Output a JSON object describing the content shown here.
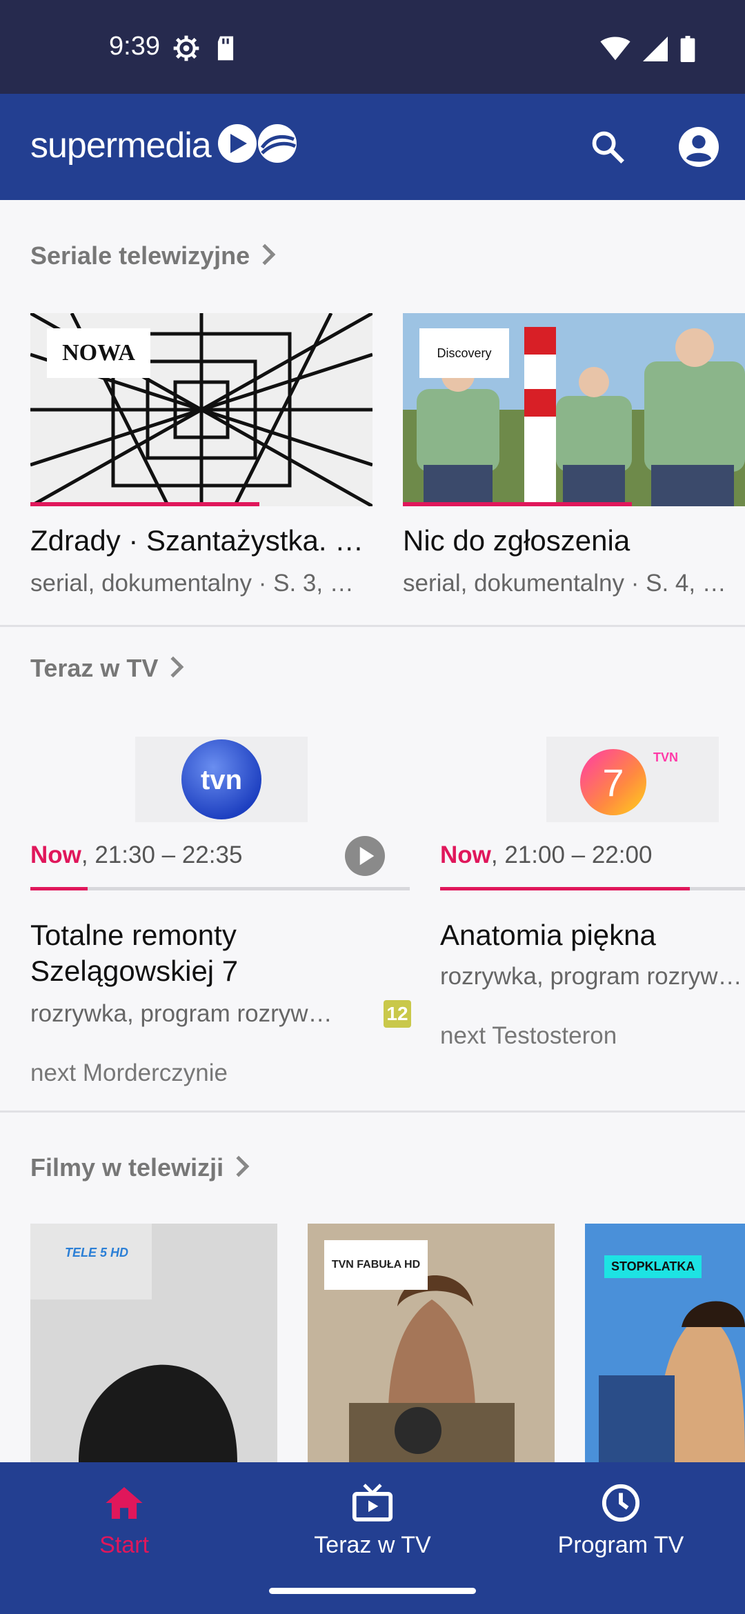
{
  "status_bar": {
    "time": "9:39"
  },
  "app_bar": {
    "logo_text": "supermedia"
  },
  "sections": {
    "series": {
      "title": "Seriale telewizyjne",
      "cards": [
        {
          "title": "Zdrady · Szantażystka. …",
          "subtitle": "serial, dokumentalny · S. 3, …",
          "channel": "NOWA",
          "progress": 0.67
        },
        {
          "title": "Nic do zgłoszenia",
          "subtitle": "serial, dokumentalny · S. 4, …",
          "channel": "Discovery",
          "progress": 0.67
        }
      ]
    },
    "now_tv": {
      "title": "Teraz w TV",
      "items": [
        {
          "channel": "tvn",
          "now_label": "Now",
          "time": ", 21:30 – 22:35",
          "progress": 0.15,
          "title": "Totalne remonty Szelągowskiej 7",
          "subtitle": "rozrywka, program rozryw…",
          "age_rating": "12",
          "next": "next Morderczynie"
        },
        {
          "channel": "TVN 7",
          "now_label": "Now",
          "time": ", 21:00 – 22:00",
          "progress": 0.82,
          "title": "Anatomia piękna",
          "subtitle": "rozrywka, program rozryw…",
          "next": "next Testosteron"
        }
      ]
    },
    "movies": {
      "title": "Filmy w telewizji",
      "posters": [
        {
          "channel": "TELE 5 HD"
        },
        {
          "channel": "TVN FABUŁA HD"
        },
        {
          "channel": "STOPKLATKA"
        }
      ]
    }
  },
  "bottom_nav": [
    {
      "label": "Start",
      "icon": "home-icon",
      "active": true
    },
    {
      "label": "Teraz w TV",
      "icon": "tv-icon",
      "active": false
    },
    {
      "label": "Program TV",
      "icon": "clock-icon",
      "active": false
    }
  ],
  "colors": {
    "primary": "#233f91",
    "status_bar": "#262a4e",
    "accent": "#e0175b",
    "background": "#f7f7f9"
  }
}
